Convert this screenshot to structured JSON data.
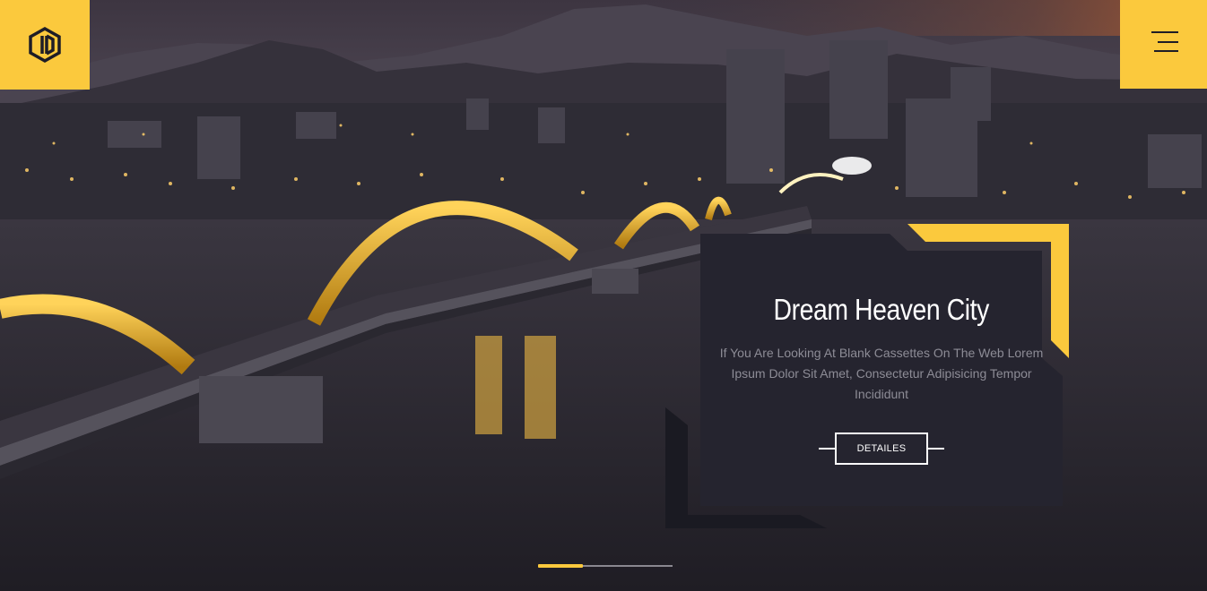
{
  "header": {
    "logo_icon": "hexagon-logo-icon",
    "menu_icon": "hamburger-menu-icon"
  },
  "slide": {
    "title": "Dream Heaven City",
    "description": "If You Are Looking At Blank Cassettes On The Web Lorem Ipsum Dolor Sit Amet, Consectetur Adipisicing Tempor Incididunt",
    "button_label": "DETAILES",
    "progress": 0.33
  },
  "colors": {
    "accent": "#fbc93d",
    "card": "#25242f",
    "card_dark": "#1a1a22"
  }
}
